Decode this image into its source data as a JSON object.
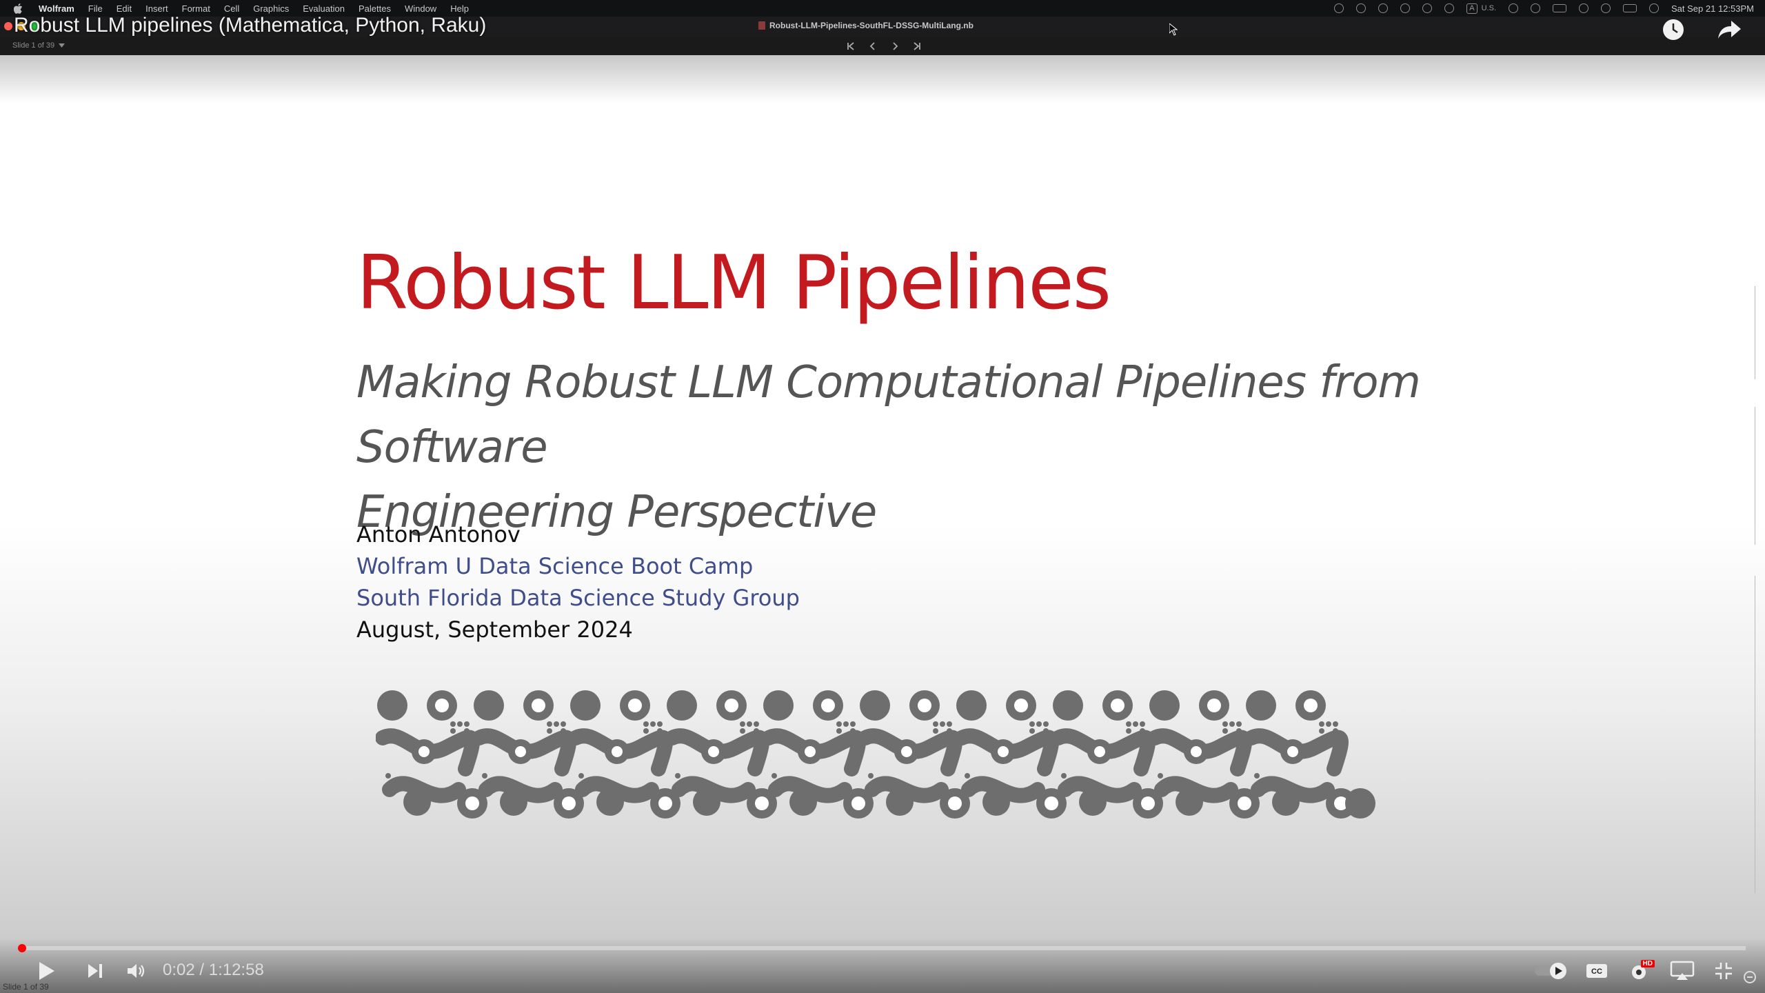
{
  "menubar": {
    "app": "Wolfram",
    "items": [
      "File",
      "Edit",
      "Insert",
      "Format",
      "Cell",
      "Graphics",
      "Evaluation",
      "Palettes",
      "Window",
      "Help"
    ],
    "keyboard_badge": "A",
    "input_source": "U.S.",
    "clock": "Sat Sep 21  12:53PM"
  },
  "notebook": {
    "filename": "Robust-LLM-Pipelines-SouthFL-DSSG-MultiLang.nb",
    "slide_selector": "Slide 1 of 39"
  },
  "video": {
    "title": "Robust LLM pipelines (Mathematica, Python, Raku)",
    "current_time": "0:02",
    "duration": "1:12:58",
    "time_display": "0:02 / 1:12:58",
    "progress_fraction": 0.0005,
    "hd_badge": "HD",
    "autoplay": true
  },
  "slide": {
    "title": "Robust LLM Pipelines",
    "subtitle_line1": "Making Robust LLM Computational Pipelines from Software",
    "subtitle_line2": "Engineering Perspective",
    "author": "Anton Antonov",
    "affiliation1": "Wolfram U Data Science Boot Camp",
    "affiliation2": "South Florida Data Science Study Group",
    "date": "August, September 2024",
    "footer": "Slide 1 of 39"
  },
  "colors": {
    "title": "#c31a1f",
    "subtitle": "#555555",
    "link": "#3f4d8a",
    "progress": "#ff0000",
    "pattern": "#6e6e6e"
  }
}
